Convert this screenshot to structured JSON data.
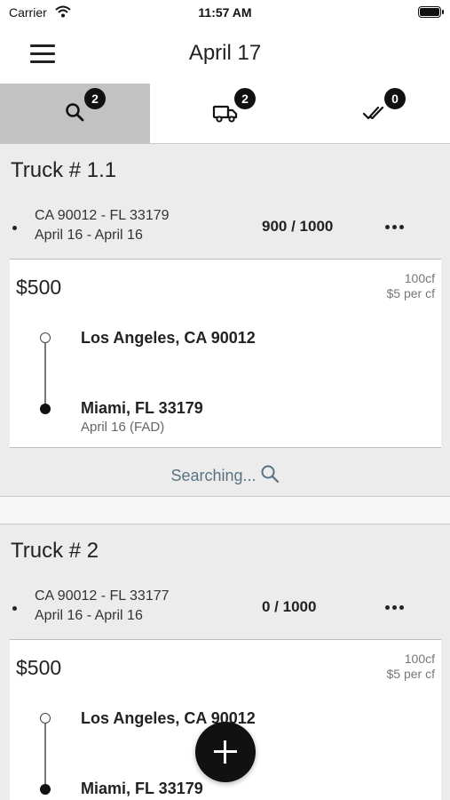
{
  "status": {
    "carrier": "Carrier",
    "time": "11:57 AM"
  },
  "header": {
    "title": "April 17",
    "menu_icon": "hamburger-menu-icon"
  },
  "tabs": [
    {
      "icon": "search-icon",
      "badge": "2",
      "active": true
    },
    {
      "icon": "truck-icon",
      "badge": "2",
      "active": false
    },
    {
      "icon": "double-check-icon",
      "badge": "0",
      "active": false
    }
  ],
  "trucks": [
    {
      "title": "Truck # 1.1",
      "route": "CA 90012 - FL 33179",
      "dates": "April 16 - April 16",
      "capacity": "900 / 1000",
      "load": {
        "price": "$500",
        "volume": "100cf",
        "rate": "$5 per cf",
        "origin": "Los Angeles, CA 90012",
        "destination": "Miami, FL 33179",
        "deliver_date": "April 16 (FAD)"
      },
      "status_text": "Searching..."
    },
    {
      "title": "Truck # 2",
      "route": "CA 90012 - FL 33177",
      "dates": "April 16 - April 16",
      "capacity": "0 / 1000",
      "load": {
        "price": "$500",
        "volume": "100cf",
        "rate": "$5 per cf",
        "origin": "Los Angeles, CA 90012",
        "destination": "Miami, FL 33179"
      }
    }
  ],
  "colors": {
    "active_tab": "#c2c2c2",
    "searching_text": "#5a7280",
    "fab": "#111111"
  }
}
